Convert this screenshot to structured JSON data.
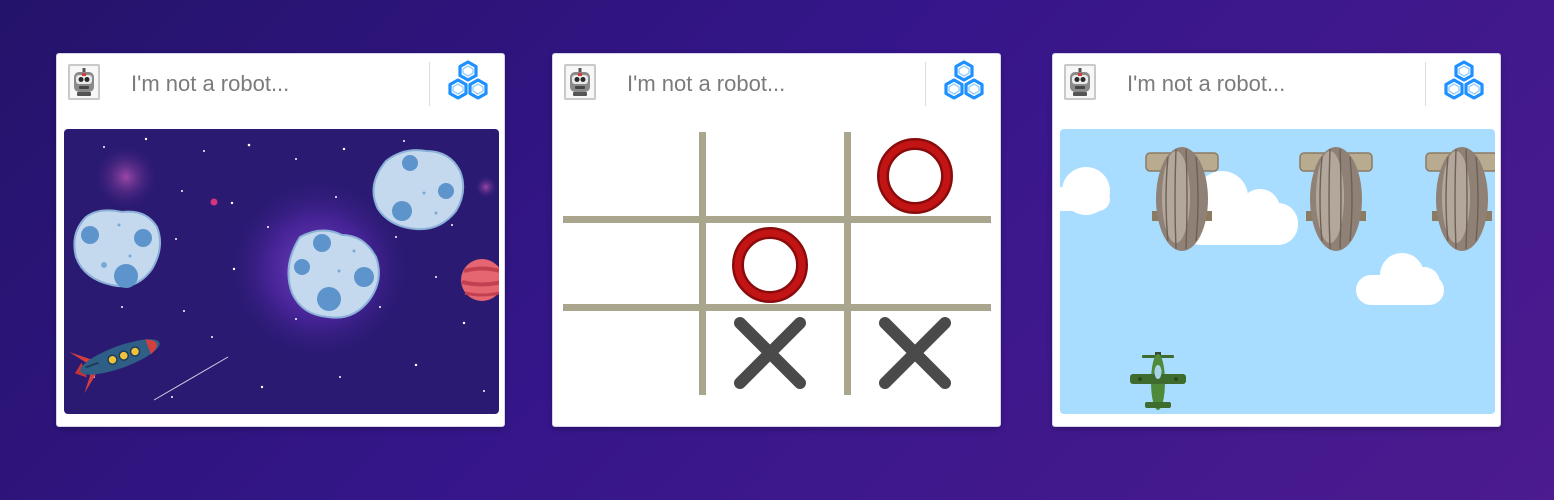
{
  "colors": {
    "page_background": "#3a1780",
    "card_background": "#ffffff",
    "placeholder_text": "#7b7b7b",
    "brand_blue": "#1e90ff",
    "space_background": "#2a1a72",
    "tictactoe_grid": "#a9a68d",
    "tictactoe_o": "#b30d0d",
    "tictactoe_x": "#4a4a4a",
    "sky_background": "#a9ddff"
  },
  "cards": [
    {
      "prompt": "I'm not a robot...",
      "checkbox_icon": "robot-icon",
      "logo_icon": "hexagon-cluster-logo",
      "game": "space-asteroids"
    },
    {
      "prompt": "I'm not a robot...",
      "checkbox_icon": "robot-icon",
      "logo_icon": "hexagon-cluster-logo",
      "game": "tic-tac-toe",
      "board": [
        "",
        "",
        "O",
        "",
        "O",
        "",
        "",
        "X",
        "X"
      ]
    },
    {
      "prompt": "I'm not a robot...",
      "checkbox_icon": "robot-icon",
      "logo_icon": "hexagon-cluster-logo",
      "game": "airplane-zeppelins"
    }
  ]
}
